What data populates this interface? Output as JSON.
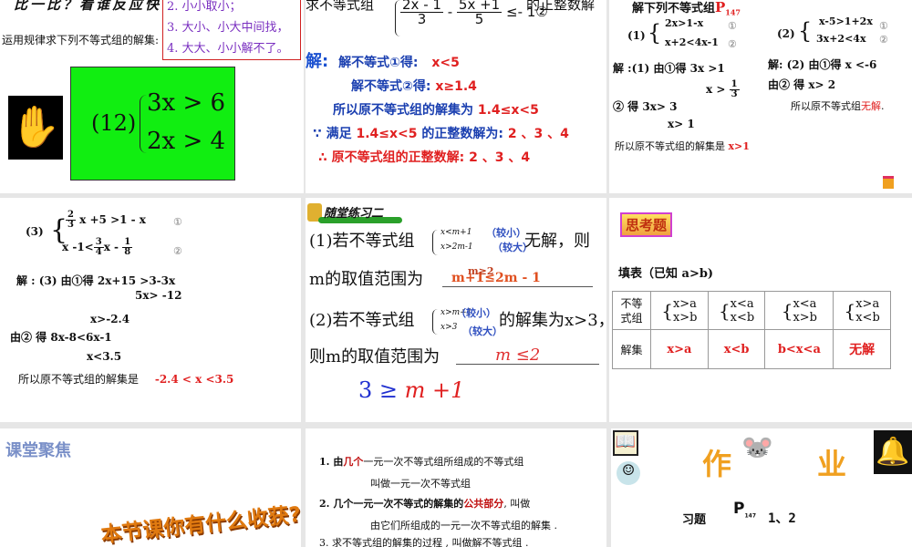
{
  "s1": {
    "title": "比一比？看谁反应快",
    "rules": [
      "2. 小小取小；",
      "3. 大小、小大中间找，",
      "4. 大大、小小解不了。"
    ],
    "prompt": "运用规律求下列不等式组的解集:",
    "label": "(12)",
    "eq1": "3x > 6",
    "eq2": "2x > 4"
  },
  "s2": {
    "q": "求不等式组",
    "q_end": "的正整数解",
    "f1n": "2x - 1",
    "f1d": "3",
    "minus": "-",
    "f2n": "5x +1",
    "f2d": "5",
    "rhs": "≤- 1②",
    "jie": "解:",
    "l1": "解不等式①得:",
    "l1v": "x<5",
    "l2": "解不等式②得:",
    "l2v": "x≥1.4",
    "l3": "所以原不等式组的解集为",
    "l3v": "1.4≤x<5",
    "l4": "∵ 满足",
    "l4v": "1.4≤x<5",
    "l4b": "的正整数解为:",
    "l4c": "2 、3 、4",
    "l5": "∴ 原不等式组的正整数解:",
    "l5v": "2 、3 、4"
  },
  "s3": {
    "title": "解下列不等式组",
    "page": "P",
    "page_sub": "147",
    "p1": "(1)",
    "p1a": "2x>1-x",
    "p1b": "x+2<4x-1",
    "c1": "①",
    "c2": "②",
    "p2": "(2)",
    "p2a": "x-5>1+2x",
    "p2b": "3x+2<4x",
    "s1a": "解 :(1)  由①得   3x >1",
    "s1b": "x >",
    "s1bn": "1",
    "s1bd": "3",
    "s1c": "②  得     3x> 3",
    "s1d": "x> 1",
    "s1e": "所以原不等式组的解集是",
    "s1ev": "x>1",
    "s2a": "解:  (2)  由①得  x <-6",
    "s2b": "由②  得      x> 2",
    "s2c": "所以原不等式组",
    "s2cv": "无解",
    "s2cd": "."
  },
  "s4": {
    "label": "(3)",
    "e1": "x +5 >1 - x",
    "e1n": "2",
    "e1d": "3",
    "e2a": "x -1<",
    "e2n": "3",
    "e2d": "4",
    "e2b": "x -",
    "e2n2": "1",
    "e2d2": "8",
    "c1": "①",
    "c2": "②",
    "l1": "解 : (3)  由①得    2x+15 >3-3x",
    "l2": "5x> -12",
    "l3": "x>-2.4",
    "l4": "由②  得      8x-8<6x-1",
    "l5": "x<3.5",
    "l6": "所以原不等式组的解集是",
    "l6v": "-2.4 < x <3.5"
  },
  "s5": {
    "title": "随堂练习二",
    "q1a": "(1)若不等式组",
    "q1s1": "x<m+1",
    "q1s2": "x>2m-1",
    "q1n1": "（较小）",
    "q1n2": "（较大）",
    "q1b": "无解，则",
    "q1c": "m的取值范围为",
    "q1ans": "m+1≤2m - 1",
    "q1ans2": "m≥2",
    "q2a": "(2)若不等式组",
    "q2s1": "x>m+1",
    "q2s2": "x>3",
    "q2n1": "（较小）",
    "q2n2": "（较大）",
    "q2b": "的解集为x>3，",
    "q2c": "则m的取值范围为",
    "q2ans": "m ≤2",
    "ineq": "3 ≥",
    "ineq2": "m +1"
  },
  "s6": {
    "badge": "思考题",
    "title": "填表（已知 a>b)",
    "row1": "不等式组",
    "row2": "解集",
    "systems": [
      [
        "x>a",
        "x>b"
      ],
      [
        "x<a",
        "x<b"
      ],
      [
        "x<a",
        "x>b"
      ],
      [
        "x>a",
        "x<b"
      ]
    ],
    "answers": [
      "x>a",
      "x<b",
      "b<x<a",
      "无解"
    ]
  },
  "s7": {
    "title": "课堂聚焦",
    "art": "本节课你有什么收获?"
  },
  "s8": {
    "i1a": "1.  由",
    "i1r": "几个",
    "i1b": "一元一次不等式组所组成的不等式组",
    "i1c": "叫做一元一次不等式组",
    "i2a": "2.  几个一元一次不等式的解集的",
    "i2r": "公共部分",
    "i2b": ", 叫做",
    "i2c": "由它们所组成的一元一次不等式组的解集 .",
    "i3": "3.  求不等式组的解集的过程 , 叫做解不等式组 ."
  },
  "s9": {
    "t1": "作",
    "t2": "业",
    "ex": "习题",
    "p": "P",
    "psub": "147",
    "nums": "1、2"
  }
}
